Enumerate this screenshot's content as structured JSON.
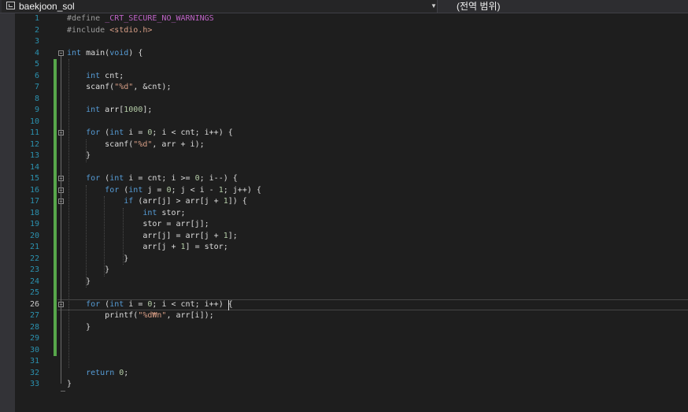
{
  "navigation_bar": {
    "project_scope": "baekjoon_sol",
    "member_scope": "(전역 범위)"
  },
  "editor": {
    "current_line": "26",
    "lines": [
      {
        "n": "1",
        "t": "#define _CRT_SECURE_NO_WARNINGS"
      },
      {
        "n": "2",
        "t": "#include <stdio.h>"
      },
      {
        "n": "3",
        "t": ""
      },
      {
        "n": "4",
        "t": "int main(void) {"
      },
      {
        "n": "5",
        "t": ""
      },
      {
        "n": "6",
        "t": "    int cnt;"
      },
      {
        "n": "7",
        "t": "    scanf(\"%d\", &cnt);"
      },
      {
        "n": "8",
        "t": ""
      },
      {
        "n": "9",
        "t": "    int arr[1000];"
      },
      {
        "n": "10",
        "t": ""
      },
      {
        "n": "11",
        "t": "    for (int i = 0; i < cnt; i++) {"
      },
      {
        "n": "12",
        "t": "        scanf(\"%d\", arr + i);"
      },
      {
        "n": "13",
        "t": "    }"
      },
      {
        "n": "14",
        "t": ""
      },
      {
        "n": "15",
        "t": "    for (int i = cnt; i >= 0; i--) {"
      },
      {
        "n": "16",
        "t": "        for (int j = 0; j < i - 1; j++) {"
      },
      {
        "n": "17",
        "t": "            if (arr[j] > arr[j + 1]) {"
      },
      {
        "n": "18",
        "t": "                int stor;"
      },
      {
        "n": "19",
        "t": "                stor = arr[j];"
      },
      {
        "n": "20",
        "t": "                arr[j] = arr[j + 1];"
      },
      {
        "n": "21",
        "t": "                arr[j + 1] = stor;"
      },
      {
        "n": "22",
        "t": "            }"
      },
      {
        "n": "23",
        "t": "        }"
      },
      {
        "n": "24",
        "t": "    }"
      },
      {
        "n": "25",
        "t": ""
      },
      {
        "n": "26",
        "t": "    for (int i = 0; i < cnt; i++) {"
      },
      {
        "n": "27",
        "t": "        printf(\"%d₩n\", arr[i]);"
      },
      {
        "n": "28",
        "t": "    }"
      },
      {
        "n": "29",
        "t": ""
      },
      {
        "n": "30",
        "t": ""
      },
      {
        "n": "31",
        "t": ""
      },
      {
        "n": "32",
        "t": "    return 0;"
      },
      {
        "n": "33",
        "t": "}"
      }
    ]
  },
  "colors": {
    "keyword": "#569cd6",
    "preprocessor": "#9b9b9b",
    "string": "#d69d85",
    "macro": "#bd63c5",
    "number": "#b5cea8",
    "line_number": "#2b91af",
    "change_bar": "#57a64a"
  }
}
